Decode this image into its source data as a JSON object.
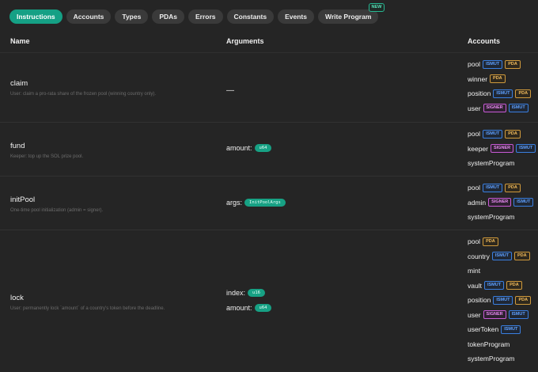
{
  "tabs": [
    {
      "label": "Instructions",
      "active": true
    },
    {
      "label": "Accounts"
    },
    {
      "label": "Types"
    },
    {
      "label": "PDAs"
    },
    {
      "label": "Errors"
    },
    {
      "label": "Constants"
    },
    {
      "label": "Events"
    },
    {
      "label": "Write Program",
      "badge": "NEW"
    }
  ],
  "columns": {
    "name": "Name",
    "arguments": "Arguments",
    "accounts": "Accounts"
  },
  "badges": {
    "ismut": "ISMUT",
    "pda": "PDA",
    "signer": "SIGNER"
  },
  "instructions": [
    {
      "name": "claim",
      "description": "User: claim a pro-rata share of the frozen pool (winning country only).",
      "args_empty": "—",
      "args": [],
      "accounts": [
        {
          "name": "pool",
          "flags": [
            "ismut",
            "pda"
          ]
        },
        {
          "name": "winner",
          "flags": [
            "pda"
          ]
        },
        {
          "name": "position",
          "flags": [
            "ismut",
            "pda"
          ]
        },
        {
          "name": "user",
          "flags": [
            "signer",
            "ismut"
          ]
        }
      ]
    },
    {
      "name": "fund",
      "description": "Keeper: top up the SOL prize pool.",
      "args": [
        {
          "name": "amount:",
          "type": "u64"
        }
      ],
      "accounts": [
        {
          "name": "pool",
          "flags": [
            "ismut",
            "pda"
          ]
        },
        {
          "name": "keeper",
          "flags": [
            "signer",
            "ismut"
          ]
        },
        {
          "name": "systemProgram",
          "flags": []
        }
      ]
    },
    {
      "name": "initPool",
      "description": "One-time pool initialization (admin = signer).",
      "args": [
        {
          "name": "args:",
          "type": "InitPoolArgs"
        }
      ],
      "accounts": [
        {
          "name": "pool",
          "flags": [
            "ismut",
            "pda"
          ]
        },
        {
          "name": "admin",
          "flags": [
            "signer",
            "ismut"
          ]
        },
        {
          "name": "systemProgram",
          "flags": []
        }
      ]
    },
    {
      "name": "lock",
      "description": "User: permanently lock `amount` of a country's token before the deadline.",
      "args": [
        {
          "name": "index:",
          "type": "u16"
        },
        {
          "name": "amount:",
          "type": "u64"
        }
      ],
      "accounts": [
        {
          "name": "pool",
          "flags": [
            "pda"
          ]
        },
        {
          "name": "country",
          "flags": [
            "ismut",
            "pda"
          ]
        },
        {
          "name": "mint",
          "flags": []
        },
        {
          "name": "vault",
          "flags": [
            "ismut",
            "pda"
          ]
        },
        {
          "name": "position",
          "flags": [
            "ismut",
            "pda"
          ]
        },
        {
          "name": "user",
          "flags": [
            "signer",
            "ismut"
          ]
        },
        {
          "name": "userToken",
          "flags": [
            "ismut"
          ]
        },
        {
          "name": "tokenProgram",
          "flags": []
        },
        {
          "name": "systemProgram",
          "flags": []
        }
      ]
    }
  ]
}
